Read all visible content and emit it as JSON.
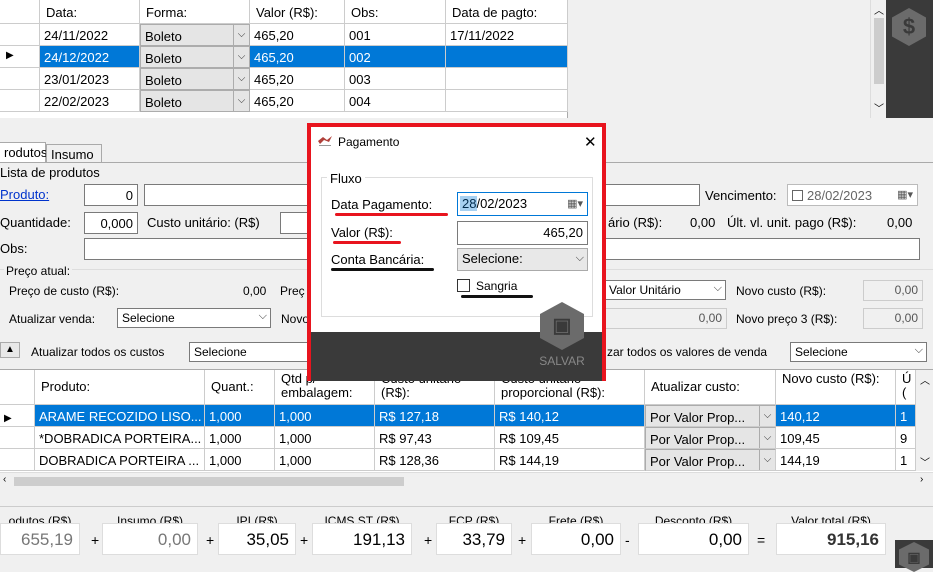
{
  "installments": {
    "columns": [
      "Data:",
      "Forma:",
      "Valor (R$):",
      "Obs:",
      "Data de pagto:"
    ],
    "rows": [
      {
        "data": "24/11/2022",
        "forma": "Boleto",
        "valor": "465,20",
        "obs": "001",
        "pagto": "17/11/2022"
      },
      {
        "data": "24/12/2022",
        "forma": "Boleto",
        "valor": "465,20",
        "obs": "002",
        "pagto": ""
      },
      {
        "data": "23/01/2023",
        "forma": "Boleto",
        "valor": "465,20",
        "obs": "003",
        "pagto": ""
      },
      {
        "data": "22/02/2023",
        "forma": "Boleto",
        "valor": "465,20",
        "obs": "004",
        "pagto": ""
      }
    ],
    "dollar_icon": "$"
  },
  "tabs": [
    "rodutos",
    "Insumo"
  ],
  "product_form": {
    "section": "Lista de produtos",
    "produto_label": "Produto:",
    "produto_code": "0",
    "vencimento_label": "Vencimento:",
    "vencimento_value": "28/02/2023",
    "quantidade_label": "Quantidade:",
    "quantidade_value": "0,000",
    "custo_label": "Custo unitário: (R$)",
    "unit_partial_label": "ário (R$):",
    "unit_partial_value": "0,00",
    "ult_label": "Últ. vl. unit. pago (R$):",
    "ult_value": "0,00",
    "obs_label": "Obs:",
    "preco_atual": "Preço atual:",
    "preco_custo_label": "Preço de custo (R$):",
    "preco_custo_value": "0,00",
    "preco_partial": "Preç",
    "valor_unitario_select": "Valor Unitário",
    "novo_custo_label": "Novo custo (R$):",
    "novo_custo_value": "0,00",
    "atualizar_venda_label": "Atualizar venda:",
    "atualizar_venda_select": "Selecione",
    "novo_partial": "Novo",
    "mid_value": "0,00",
    "novo_preco3_label": "Novo preço 3 (R$):",
    "novo_preco3_value": "0,00",
    "atualizar_custos_label": "Atualizar todos os custos",
    "atualizar_custos_select": "Selecione",
    "atualizar_valores_label": "zar todos os valores de venda",
    "atualizar_valores_select": "Selecione"
  },
  "products": {
    "columns": [
      "Produto:",
      "Quant.:",
      "Qtd p/ embalagem:",
      "Custo unitário (R$):",
      "Custo unitário proporcional (R$):",
      "Atualizar custo:",
      "Novo custo (R$):",
      "Ú ("
    ],
    "rows": [
      {
        "produto": "ARAME RECOZIDO LISO...",
        "quant": "1,000",
        "emb": "1,000",
        "custo": "R$ 127,18",
        "prop": "R$ 140,12",
        "atualizar": "Por Valor Prop...",
        "novo": "140,12",
        "last": "1"
      },
      {
        "produto": "*DOBRADICA PORTEIRA...",
        "quant": "1,000",
        "emb": "1,000",
        "custo": "R$ 97,43",
        "prop": "R$ 109,45",
        "atualizar": "Por Valor Prop...",
        "novo": "109,45",
        "last": "9"
      },
      {
        "produto": "DOBRADICA PORTEIRA ...",
        "quant": "1,000",
        "emb": "1,000",
        "custo": "R$ 128,36",
        "prop": "R$ 144,19",
        "atualizar": "Por Valor Prop...",
        "novo": "144,19",
        "last": "1"
      }
    ]
  },
  "totals": [
    {
      "label": "odutos (R$)",
      "value": "655,19",
      "op": "+"
    },
    {
      "label": "Insumo (R$)",
      "value": "0,00",
      "op": "+"
    },
    {
      "label": "IPI (R$)",
      "value": "35,05",
      "op": "+"
    },
    {
      "label": "ICMS ST (R$)",
      "value": "191,13",
      "op": "+"
    },
    {
      "label": "FCP (R$)",
      "value": "33,79",
      "op": "+"
    },
    {
      "label": "Frete (R$)",
      "value": "0,00",
      "op": "-"
    },
    {
      "label": "Desconto (R$)",
      "value": "0,00",
      "op": "="
    },
    {
      "label": "Valor total (R$)",
      "value": "915,16",
      "op": ""
    }
  ],
  "modal": {
    "title": "Pagamento",
    "group": "Fluxo",
    "data_label": "Data Pagamento:",
    "data_value": "28/02/2023",
    "valor_label": "Valor (R$):",
    "valor_value": "465,20",
    "conta_label": "Conta Bancária:",
    "conta_select": "Selecione:",
    "sangria_label": "Sangria",
    "save_label": "SALVAR",
    "close_icon": "✕"
  },
  "colors": {
    "highlight": "#e8141e",
    "selection": "#0078d7",
    "dark": "#3a3a3a"
  }
}
